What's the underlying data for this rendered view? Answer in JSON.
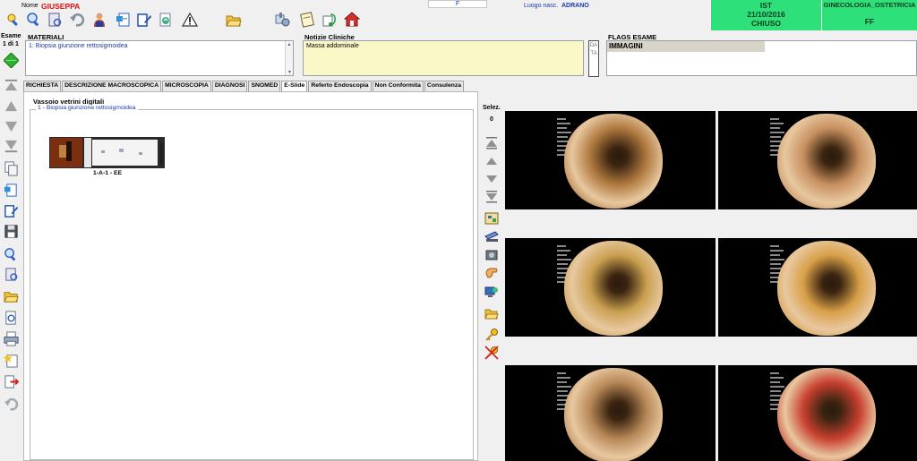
{
  "header": {
    "nome_label": "Nome",
    "nome_value": "GIUSEPPA",
    "sex_value": "F",
    "luogo_label": "Luogo nasc.",
    "luogo_value": "ADRANO",
    "status_box": {
      "line1": "IST",
      "line2": "21/10/2016",
      "line3": "CHIUSO"
    },
    "dept_box": {
      "line1": "GINECOLOGIA_OSTETRICIA",
      "line2": "FF"
    },
    "accent_green": "#2ee07a"
  },
  "toolbar": {
    "icons": [
      "key-search-icon",
      "zoom-in-icon",
      "document-icon",
      "undo-icon",
      "user-icon",
      "add-document-icon",
      "edit-document-icon",
      "refresh-document-icon",
      "warning-icon",
      "folder-open-icon",
      "tools-icon",
      "notepad-icon",
      "stethoscope-icon",
      "house-icon"
    ]
  },
  "esame": {
    "label": "Esame",
    "counter": "1 di 1"
  },
  "materiali": {
    "label": "MATERIALI",
    "item": "1: Biopsia giunzione rettosigmoidea"
  },
  "notizie": {
    "label": "Notizie Cliniche",
    "text": "Massa addominale",
    "data_button": "DATA"
  },
  "flags": {
    "label": "FLAGS ESAME",
    "value": "IMMAGINI"
  },
  "tabs": [
    {
      "label": "RICHIESTA",
      "active": false
    },
    {
      "label": "DESCRIZIONE MACROSCOPICA",
      "active": false
    },
    {
      "label": "MICROSCOPIA",
      "active": false
    },
    {
      "label": "DIAGNOSI",
      "active": false
    },
    {
      "label": "SNOMED",
      "active": false
    },
    {
      "label": "E-Slide",
      "active": true
    },
    {
      "label": "Referto Endoscopia",
      "active": false
    },
    {
      "label": "Non Conformita",
      "active": false
    },
    {
      "label": "Consulenza",
      "active": false
    }
  ],
  "eslide": {
    "title": "Vassoio vetrini digitali",
    "group_label": "1 - Biopsia giunzione rettosigmoidea",
    "slide_caption": "1-A-1 - EE"
  },
  "images": {
    "selez_label": "Selez.",
    "selez_count": "0",
    "tiles": [
      {
        "name": "endoscopy-image-1",
        "tone": "#b07a40"
      },
      {
        "name": "endoscopy-image-2",
        "tone": "#c89060"
      },
      {
        "name": "endoscopy-image-3",
        "tone": "#caa050"
      },
      {
        "name": "endoscopy-image-4",
        "tone": "#d8a048"
      },
      {
        "name": "endoscopy-image-5",
        "tone": "#b88858"
      },
      {
        "name": "endoscopy-image-6",
        "tone": "#c84030"
      }
    ]
  }
}
